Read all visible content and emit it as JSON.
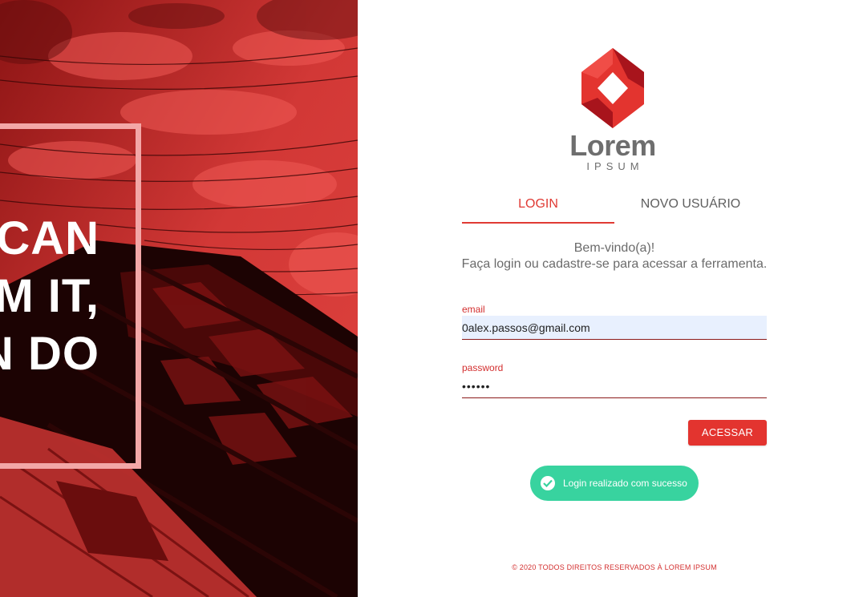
{
  "hero": {
    "lines": [
      "CAN",
      "M IT,",
      "N DO"
    ]
  },
  "logo": {
    "word": "Lorem",
    "sub": "IPSUM",
    "colors": {
      "primary": "#e3342f",
      "dark": "#a8141c",
      "text": "#6e6e6e"
    }
  },
  "tabs": [
    {
      "label": "LOGIN",
      "active": true
    },
    {
      "label": "NOVO USUÁRIO",
      "active": false
    }
  ],
  "welcome": {
    "title": "Bem-vindo(a)!",
    "subtitle": "Faça login ou cadastre-se para acessar a ferramenta."
  },
  "form": {
    "email_label": "email",
    "email_value": "0alex.passos@gmail.com",
    "password_label": "password",
    "password_value": "••••••",
    "submit_label": "ACESSAR"
  },
  "toast": {
    "icon": "check-circle-icon",
    "message": "Login realizado com sucesso",
    "color": "#38d39f"
  },
  "footer": {
    "text": "© 2020 TODOS DIREITOS RESERVADOS À LOREM IPSUM"
  }
}
